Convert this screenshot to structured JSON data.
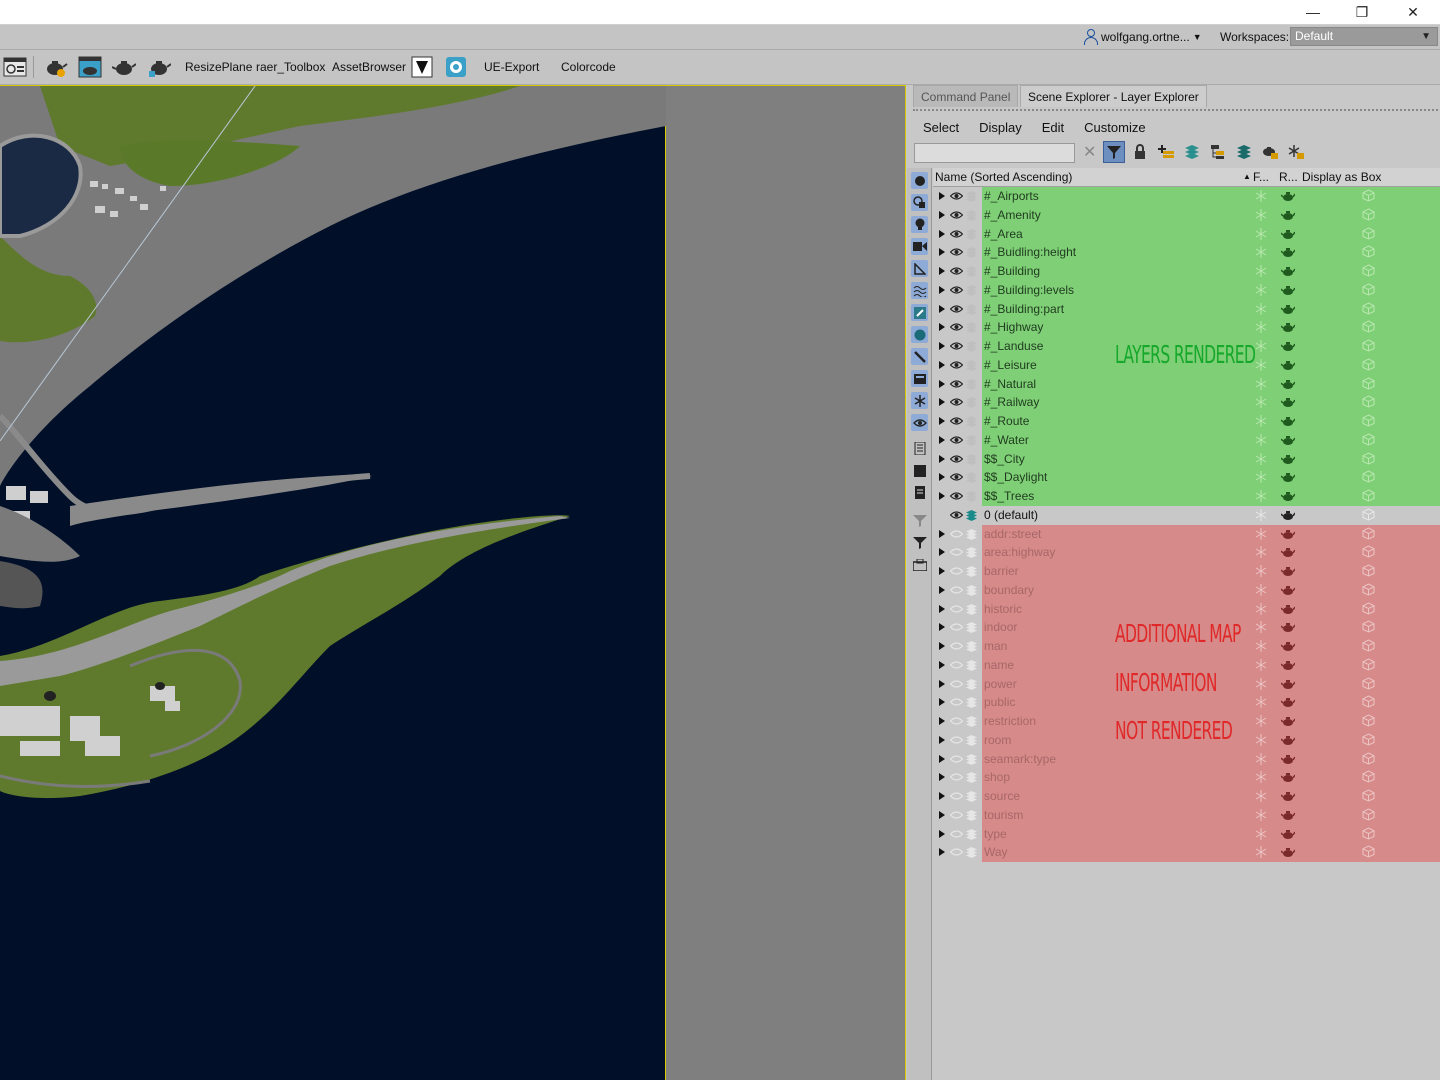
{
  "window": {
    "min": "—",
    "restore": "❐",
    "close": "✕"
  },
  "userbar": {
    "user": "wolfgang.ortne...",
    "workspaces_label": "Workspaces:",
    "workspace": "Default"
  },
  "toolbar": {
    "items": [
      "ResizePlane",
      "raer_Toolbox",
      "AssetBrowser",
      "UE-Export",
      "Colorcode"
    ]
  },
  "panel": {
    "tabs": [
      "Command Panel",
      "Scene Explorer - Layer Explorer"
    ],
    "menu": [
      "Select",
      "Display",
      "Edit",
      "Customize"
    ],
    "columns": {
      "name": "Name (Sorted Ascending)",
      "freeze": "F...",
      "render": "R...",
      "box": "Display as Box"
    },
    "sort_arrow": "▲"
  },
  "layers_rendered": [
    "#_Airports",
    "#_Amenity",
    "#_Area",
    "#_Buidling:height",
    "#_Building",
    "#_Building:levels",
    "#_Building:part",
    "#_Highway",
    "#_Landuse",
    "#_Leisure",
    "#_Natural",
    "#_Railway",
    "#_Route",
    "#_Water",
    "$$_City",
    "$$_Daylight",
    "$$_Trees"
  ],
  "default_layer": "0 (default)",
  "layers_hidden": [
    "addr:street",
    "area:highway",
    "barrier",
    "boundary",
    "historic",
    "indoor",
    "man",
    "name",
    "power",
    "public",
    "restriction",
    "room",
    "seamark:type",
    "shop",
    "source",
    "tourism",
    "type",
    "Way"
  ],
  "annotations": {
    "rendered": "LAYERS RENDERED",
    "hidden_1": "ADDITIONAL MAP",
    "hidden_2": "INFORMATION",
    "hidden_3": "NOT RENDERED"
  },
  "colors": {
    "rendered": "#7fcf76",
    "hidden": "#d78a8a",
    "annotation_green": "#15a82a",
    "annotation_red": "#e02828",
    "viewport_bg": "#010f28"
  }
}
